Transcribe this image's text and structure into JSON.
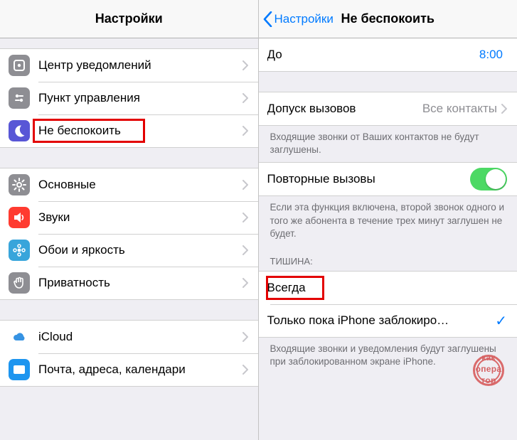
{
  "left": {
    "title": "Настройки",
    "groups": [
      [
        {
          "id": "notifications",
          "label": "Центр уведомлений",
          "icon": "notification-center-icon",
          "bg": "ic-gray"
        },
        {
          "id": "control",
          "label": "Пункт управления",
          "icon": "control-center-icon",
          "bg": "ic-gray2"
        },
        {
          "id": "dnd",
          "label": "Не беспокоить",
          "icon": "moon-icon",
          "bg": "ic-purple",
          "highlight": true
        }
      ],
      [
        {
          "id": "general",
          "label": "Основные",
          "icon": "gear-icon",
          "bg": "ic-gear"
        },
        {
          "id": "sounds",
          "label": "Звуки",
          "icon": "speaker-icon",
          "bg": "ic-red"
        },
        {
          "id": "wall",
          "label": "Обои и яркость",
          "icon": "flower-icon",
          "bg": "ic-teal"
        },
        {
          "id": "privacy",
          "label": "Приватность",
          "icon": "hand-icon",
          "bg": "ic-hand"
        }
      ],
      [
        {
          "id": "icloud",
          "label": "iCloud",
          "icon": "cloud-icon",
          "bg": "ic-cloud"
        },
        {
          "id": "mail",
          "label": "Почта, адреса, календари",
          "icon": "mail-icon",
          "bg": "ic-mail"
        }
      ]
    ]
  },
  "right": {
    "back": "Настройки",
    "title": "Не беспокоить",
    "until_label": "До",
    "until_value": "8:00",
    "allow_label": "Допуск вызовов",
    "allow_value": "Все контакты",
    "allow_footer": "Входящие звонки от Ваших контактов не будут заглушены.",
    "repeat_label": "Повторные вызовы",
    "repeat_footer": "Если эта функция включена, второй звонок одного и того же абонента в течение трех минут заглушен не будет.",
    "silence_header": "ТИШИНА:",
    "always": "Всегда",
    "locked": "Только пока iPhone заблокиро…",
    "locked_footer": "Входящие звонки и уведомления будут заглушены при заблокированном экране iPhone."
  },
  "watermark": {
    "l1": "как",
    "l2": "опера",
    "l3": "тор"
  }
}
